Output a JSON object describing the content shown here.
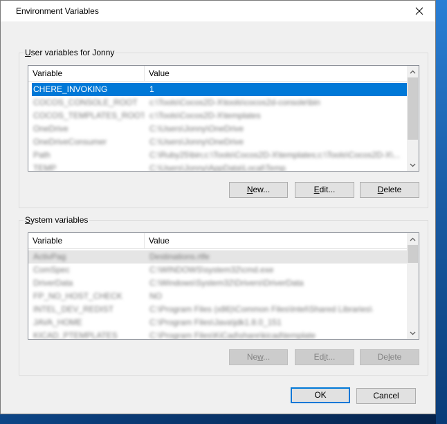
{
  "window": {
    "title": "Environment Variables"
  },
  "user_vars": {
    "group_label_prefix": "U",
    "group_label_rest": "ser variables for Jonny",
    "columns": [
      "Variable",
      "Value"
    ],
    "rows": [
      {
        "variable": "CHERE_INVOKING",
        "value": "1",
        "selected": true,
        "blurred": false
      },
      {
        "variable": "COCOS_CONSOLE_ROOT",
        "value": "c:\\Tools\\Cocos2D-X\\tools\\cocos2d-console\\bin",
        "selected": false,
        "blurred": true
      },
      {
        "variable": "COCOS_TEMPLATES_ROOT",
        "value": "c:\\Tools\\Cocos2D-X\\templates",
        "selected": false,
        "blurred": true
      },
      {
        "variable": "OneDrive",
        "value": "C:\\Users\\Jonny\\OneDrive",
        "selected": false,
        "blurred": true
      },
      {
        "variable": "OneDriveConsumer",
        "value": "C:\\Users\\Jonny\\OneDrive",
        "selected": false,
        "blurred": true
      },
      {
        "variable": "Path",
        "value": "C:\\Ruby25\\bin;c:\\Tools\\Cocos2D-X\\templates;c:\\Tools\\Cocos2D-X\\...",
        "selected": false,
        "blurred": true
      },
      {
        "variable": "TEMP",
        "value": "C:\\Users\\Jonny\\AppData\\Local\\Temp",
        "selected": false,
        "blurred": true
      }
    ],
    "buttons": {
      "new": {
        "ul": "N",
        "rest": "ew..."
      },
      "edit": {
        "ul": "E",
        "rest": "dit..."
      },
      "delete": {
        "ul": "D",
        "rest": "elete"
      }
    }
  },
  "system_vars": {
    "group_label_prefix": "S",
    "group_label_rest": "ystem variables",
    "columns": [
      "Variable",
      "Value"
    ],
    "rows": [
      {
        "variable": "ActivPag",
        "value": "Destinations.rtfe"
      },
      {
        "variable": "ComSpec",
        "value": "C:\\WINDOWS\\system32\\cmd.exe"
      },
      {
        "variable": "DriverData",
        "value": "C:\\Windows\\System32\\Drivers\\DriverData"
      },
      {
        "variable": "FP_NO_HOST_CHECK",
        "value": "NO"
      },
      {
        "variable": "INTEL_DEV_REDIST",
        "value": "C:\\Program Files (x86)\\Common Files\\Intel\\Shared Libraries\\"
      },
      {
        "variable": "JAVA_HOME",
        "value": "C:\\Program Files\\Java\\jdk1.8.0_151"
      },
      {
        "variable": "KICAD_PTEMPLATES",
        "value": "C:\\Program Files\\KiCad\\share\\kicad\\template"
      }
    ],
    "buttons": {
      "new": {
        "ul": "w",
        "pre": "Ne",
        "rest": "..."
      },
      "edit": {
        "ul": "i",
        "pre": "Ed",
        "rest": "t..."
      },
      "delete": {
        "ul": "l",
        "pre": "De",
        "rest": "ete"
      }
    }
  },
  "footer": {
    "ok": "OK",
    "cancel": "Cancel"
  },
  "colors": {
    "selection": "#0078d7",
    "dialog_bg": "#f0f0f0"
  },
  "icons": {
    "close": "close-icon",
    "scroll_up": "chevron-up-icon",
    "scroll_down": "chevron-down-icon"
  }
}
